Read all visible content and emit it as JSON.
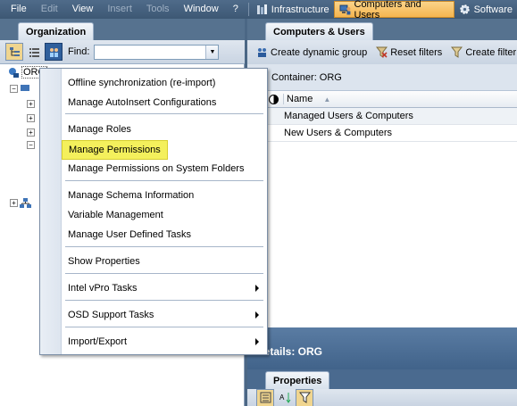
{
  "menubar": {
    "items": [
      {
        "label": "File",
        "enabled": true
      },
      {
        "label": "Edit",
        "enabled": false
      },
      {
        "label": "View",
        "enabled": true
      },
      {
        "label": "Insert",
        "enabled": false
      },
      {
        "label": "Tools",
        "enabled": false
      },
      {
        "label": "Window",
        "enabled": true
      },
      {
        "label": "?",
        "enabled": true
      }
    ],
    "tools": [
      {
        "label": "Infrastructure",
        "icon": "infrastructure-icon",
        "active": false
      },
      {
        "label": "Computers and Users",
        "icon": "computers-users-icon",
        "active": true
      },
      {
        "label": "Software",
        "icon": "software-gear-icon",
        "active": false
      }
    ]
  },
  "left": {
    "tab": "Organization",
    "find_label": "Find:",
    "find_value": "",
    "tree_root": "ORG"
  },
  "right": {
    "tab": "Computers & Users",
    "toolbar": [
      {
        "label": "Create dynamic group",
        "icon": "dynamic-group-icon"
      },
      {
        "label": "Reset filters",
        "icon": "reset-filter-icon"
      },
      {
        "label": "Create filter",
        "icon": "create-filter-icon"
      }
    ],
    "container": "Container: ORG",
    "grid": {
      "column": "Name",
      "rows": [
        "Managed Users & Computers",
        "New Users & Computers"
      ]
    },
    "details": "Details: ORG",
    "props_tab": "Properties"
  },
  "context_menu": {
    "items": [
      "Offline synchronization (re-import)",
      "Manage AutoInsert Configurations",
      "Manage Roles",
      "Manage Permissions",
      "Manage Permissions on System Folders",
      "Manage Schema Information",
      "Variable Management",
      "Manage User Defined Tasks",
      "Show Properties",
      "Intel vPro Tasks",
      "OSD Support Tasks",
      "Import/Export"
    ],
    "highlighted": "Manage Permissions"
  },
  "colors": {
    "highlight": "#f4f05c",
    "active_tool": "#f5b54f",
    "header": "#4b6785"
  }
}
